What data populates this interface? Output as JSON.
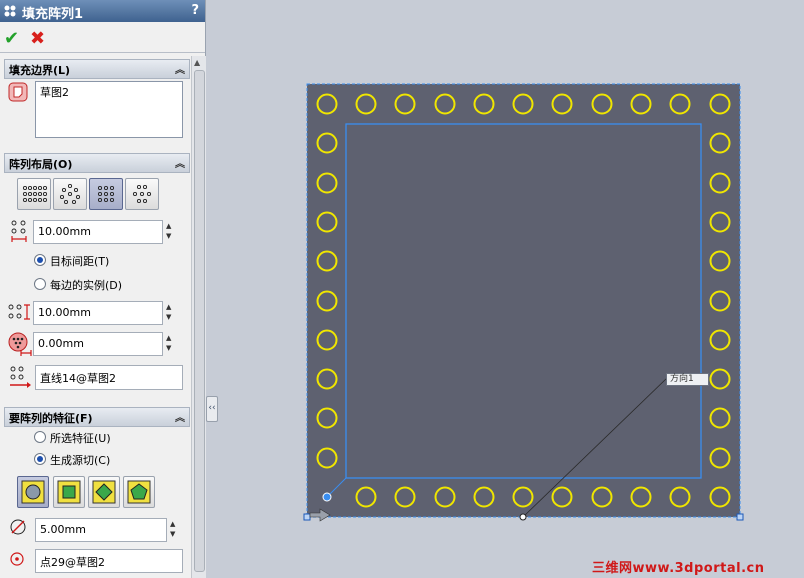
{
  "panel": {
    "title": "填充阵列1",
    "help": "?",
    "ok": "✔",
    "cancel": "✖"
  },
  "fill_boundary": {
    "header": "填充边界(L)",
    "selection": "草图2"
  },
  "pattern_layout": {
    "header": "阵列布局(O)",
    "spacing": "10.00mm",
    "option_target_spacing": "目标间距(T)",
    "option_instances_per_side": "每边的实例(D)",
    "margin": "10.00mm",
    "angle": "0.00mm",
    "direction": "直线14@草图2"
  },
  "features_to_pattern": {
    "header": "要阵列的特征(F)",
    "option_selected_features": "所选特征(U)",
    "option_create_seed_cut": "生成源切(C)",
    "diameter": "5.00mm",
    "vertex": "点29@草图2"
  },
  "viewport": {
    "direction_label": "方向1",
    "colors": {
      "fill": "#5e6170",
      "circle": "#f0e600",
      "boundary": "#3a8ef0"
    }
  },
  "watermark": "三维网www.3dportal.cn"
}
